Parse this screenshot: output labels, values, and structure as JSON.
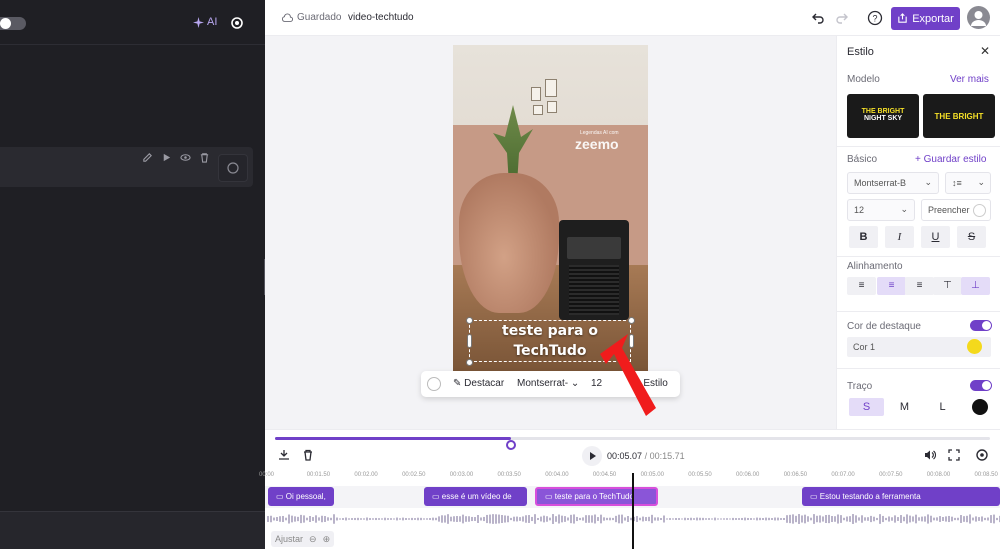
{
  "app": {
    "ai_label": "AI",
    "saved_label": "Guardado",
    "project_name": "video-techtudo",
    "export_label": "Exportar"
  },
  "video": {
    "watermark_small": "Legendas AI com",
    "watermark_logo": "zeemo",
    "subtitle_text": "teste para o TechTudo"
  },
  "floating_toolbar": {
    "highlight_label": "Destacar",
    "font": "Montserrat-",
    "size": "12",
    "style_label": "Estilo"
  },
  "style_panel": {
    "title": "Estilo",
    "model_label": "Modelo",
    "see_more": "Ver mais",
    "models": [
      {
        "line1": "THE BRIGHT",
        "line2": "NIGHT SKY"
      },
      {
        "line1": "THE BRIGHT",
        "line2": ""
      }
    ],
    "basic_label": "Básico",
    "save_style": "+ Guardar estilo",
    "font_select": "Montserrat-B",
    "size_select": "12",
    "fill_label": "Preencher",
    "alignment_label": "Alinhamento",
    "highlight_color_label": "Cor de destaque",
    "color1_label": "Cor 1",
    "highlight_color": "#f4d91c",
    "outline_label": "Traço",
    "sizes": [
      "S",
      "M",
      "L"
    ],
    "accent": "#7040c8"
  },
  "timeline": {
    "current_time": "00:05.07",
    "separator": "/",
    "total_time": "00:15.71",
    "progress": 0.33,
    "ticks": [
      "00:00",
      "00:01.50",
      "00:02.00",
      "00:02.50",
      "00:03.00",
      "00:03.50",
      "00:04.00",
      "00:04.50",
      "00:05.00",
      "00:05.50",
      "00:06.00",
      "00:06.50",
      "00:07.00",
      "00:07.50",
      "00:08.00",
      "00:08.50"
    ],
    "clips": [
      {
        "label": "Oi pessoal,"
      },
      {
        "label": "esse é um vídeo de"
      },
      {
        "label": "teste para o TechTudo"
      },
      {
        "label": "Estou testando a ferramenta"
      }
    ],
    "zoom_label": "Ajustar"
  }
}
